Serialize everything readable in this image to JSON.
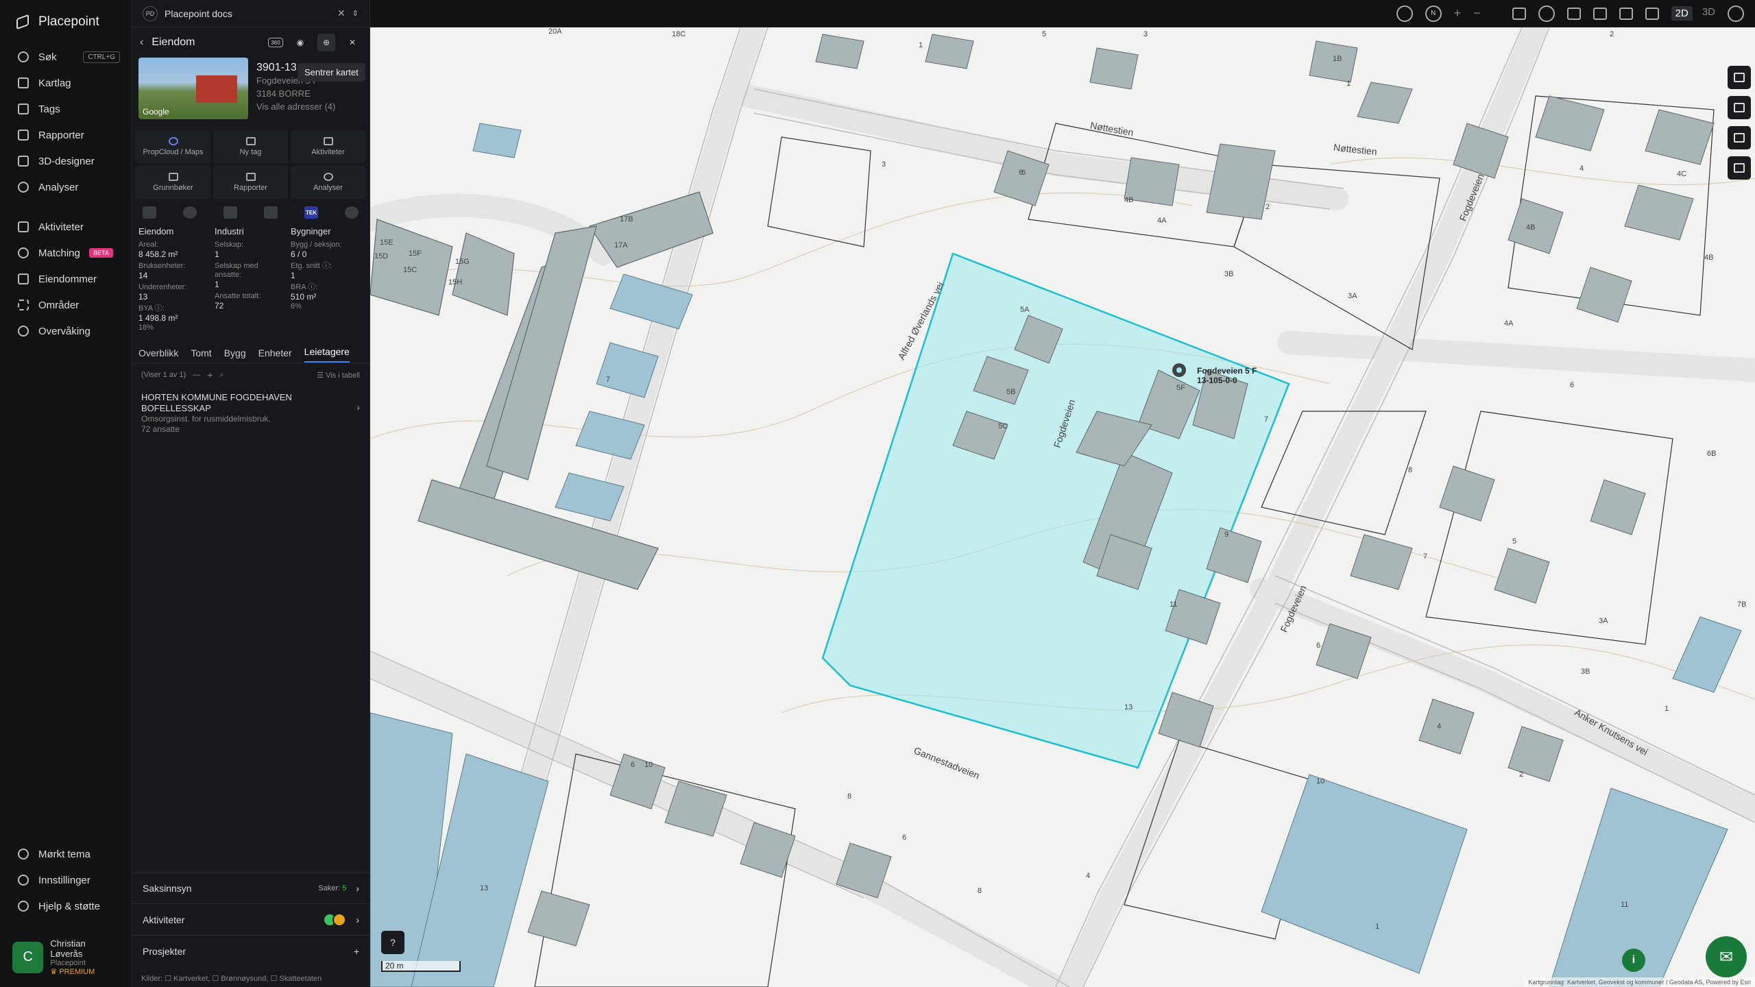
{
  "nav": {
    "brand": "Placepoint",
    "items": [
      {
        "label": "Søk",
        "shortcut": "CTRL+G"
      },
      {
        "label": "Kartlag"
      },
      {
        "label": "Tags"
      },
      {
        "label": "Rapporter"
      },
      {
        "label": "3D-designer"
      },
      {
        "label": "Analyser"
      },
      {
        "label": "Aktiviteter"
      },
      {
        "label": "Matching",
        "badge": "BETA"
      },
      {
        "label": "Eiendommer"
      },
      {
        "label": "Områder"
      },
      {
        "label": "Overvåking"
      }
    ],
    "bottom": [
      {
        "label": "Mørkt tema"
      },
      {
        "label": "Innstillinger"
      },
      {
        "label": "Hjelp & støtte"
      }
    ],
    "user": {
      "initial": "C",
      "name": "Christian Løverås",
      "org": "Placepoint",
      "tier": "PREMIUM"
    }
  },
  "panel": {
    "doc_badge": "PD",
    "doc_title": "Placepoint docs",
    "header_title": "Eiendom",
    "tooltip": "Sentrer kartet",
    "property": {
      "id": "3901-13",
      "address": "Fogdeveien 5 F",
      "postal": "3184 BORRE",
      "all_addresses": "Vis alle adresser (4)",
      "photo_credit": "Google"
    },
    "actions": [
      "PropCloud / Maps",
      "Ny tag",
      "Aktiviteter",
      "Grunnbøker",
      "Rapporter",
      "Analyser"
    ],
    "source_tek": "TEK",
    "stats": {
      "col1": {
        "title": "Eiendom",
        "rows": [
          {
            "label": "Areal:",
            "value": "8 458.2 m²"
          },
          {
            "label": "Bruksenheter:",
            "value": "14"
          },
          {
            "label": "Underenheter:",
            "value": "13"
          },
          {
            "label": "BYA ⓘ:",
            "value": "1 498.8 m²",
            "pct": "18%"
          }
        ]
      },
      "col2": {
        "title": "Industri",
        "rows": [
          {
            "label": "Selskap:",
            "value": "1"
          },
          {
            "label": "Selskap med ansatte:",
            "value": "1"
          },
          {
            "label": "Ansatte totalt:",
            "value": "72"
          }
        ]
      },
      "col3": {
        "title": "Bygninger",
        "rows": [
          {
            "label": "Bygg / seksjon:",
            "value": "6 / 0"
          },
          {
            "label": "Etg. snitt ⓘ:",
            "value": "1"
          },
          {
            "label": "BRA ⓘ:",
            "value": "510 m²",
            "pct": "6%"
          }
        ]
      }
    },
    "tabs": [
      "Overblikk",
      "Tomt",
      "Bygg",
      "Enheter",
      "Leietagere"
    ],
    "active_tab": "Leietagere",
    "list_count": "(Viser 1 av 1)",
    "list_table_toggle": "Vis i tabell",
    "tenants": [
      {
        "name": "HORTEN KOMMUNE FOGDEHAVEN BOFELLESSKAP",
        "desc": "Omsorgsinst. for rusmiddelmisbruk.",
        "staff": "72 ansatte"
      }
    ],
    "sections": {
      "saksinnsyn": "Saksinnsyn",
      "saker_label": "Saker:",
      "saker_count": "5",
      "aktiviteter": "Aktiviteter",
      "prosjekter": "Prosjekter"
    },
    "sources_line": "Kilder: ☐ Kartverket, ☐ Brønnøysund, ☐ Skatteetaten"
  },
  "topbar": {
    "compass": "N",
    "view_2d": "2D",
    "view_3d": "3D"
  },
  "map": {
    "scale_label": "20 m",
    "attribution": "Kartgrunnlag: Kartverket, Geovekst og kommuner / Geodata AS, Powered by Esri",
    "selected_label": "Fogdeveien 5 F",
    "selected_matrikkel": "13-105-0-0",
    "street_labels": [
      "Nøttestien",
      "Nøttestien",
      "Fogdeveien",
      "Alfred Øverlands vei",
      "Fogdeveien",
      "Fogdeveien",
      "Gannestadveien",
      "Anker Knutsens vei"
    ],
    "building_labels": [
      "20A",
      "18C",
      "1",
      "5",
      "3",
      "1B",
      "2",
      "1",
      "4",
      "4C",
      "4B",
      "4B",
      "6",
      "3",
      "6",
      "4B",
      "4A",
      "2",
      "3B",
      "3A",
      "17B",
      "17A",
      "15E",
      "15F",
      "15D",
      "15C",
      "15G",
      "15H",
      "5A",
      "5B",
      "5C",
      "5F",
      "7",
      "7",
      "8",
      "5",
      "6B",
      "6",
      "4A",
      "9",
      "11",
      "13",
      "6",
      "3A",
      "3B",
      "1",
      "7B",
      "4",
      "2",
      "10",
      "6",
      "8",
      "6",
      "4",
      "8",
      "13",
      "10",
      "1",
      "11",
      "7"
    ]
  }
}
